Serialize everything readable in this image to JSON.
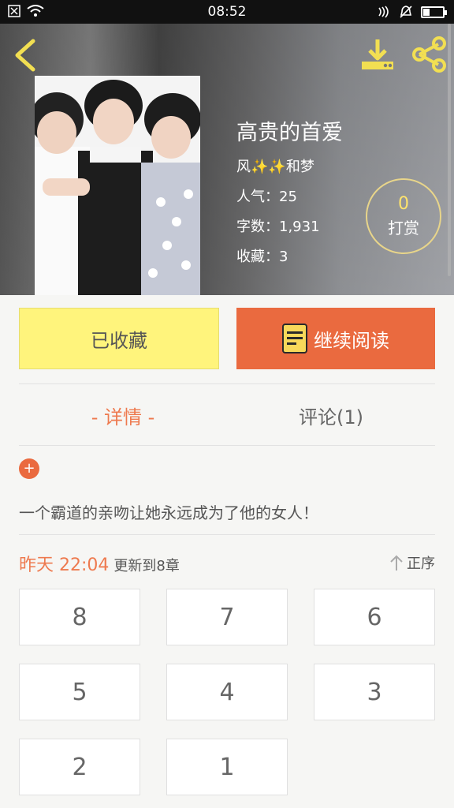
{
  "status_bar": {
    "time": "08:52"
  },
  "book": {
    "title": "高贵的首爱",
    "author": "风✨✨和梦",
    "popularity": "人气：25",
    "word_count": "字数：1,931",
    "favorites": "收藏：3"
  },
  "reward": {
    "count": "0",
    "label": "打赏"
  },
  "actions": {
    "favorited_label": "已收藏",
    "continue_label": "继续阅读"
  },
  "tabs": [
    {
      "label": "- 详情 -"
    },
    {
      "label": "评论(1)"
    }
  ],
  "description": "一个霸道的亲吻让她永远成为了他的女人！",
  "update": {
    "time": "昨天 22:04",
    "text": "更新到8章",
    "order_label": "正序"
  },
  "chapters": [
    "8",
    "7",
    "6",
    "5",
    "4",
    "3",
    "2",
    "1"
  ],
  "colors": {
    "accent": "#ea6a3f",
    "favorite": "#fff47c",
    "reward_border": "#e8d58a"
  }
}
